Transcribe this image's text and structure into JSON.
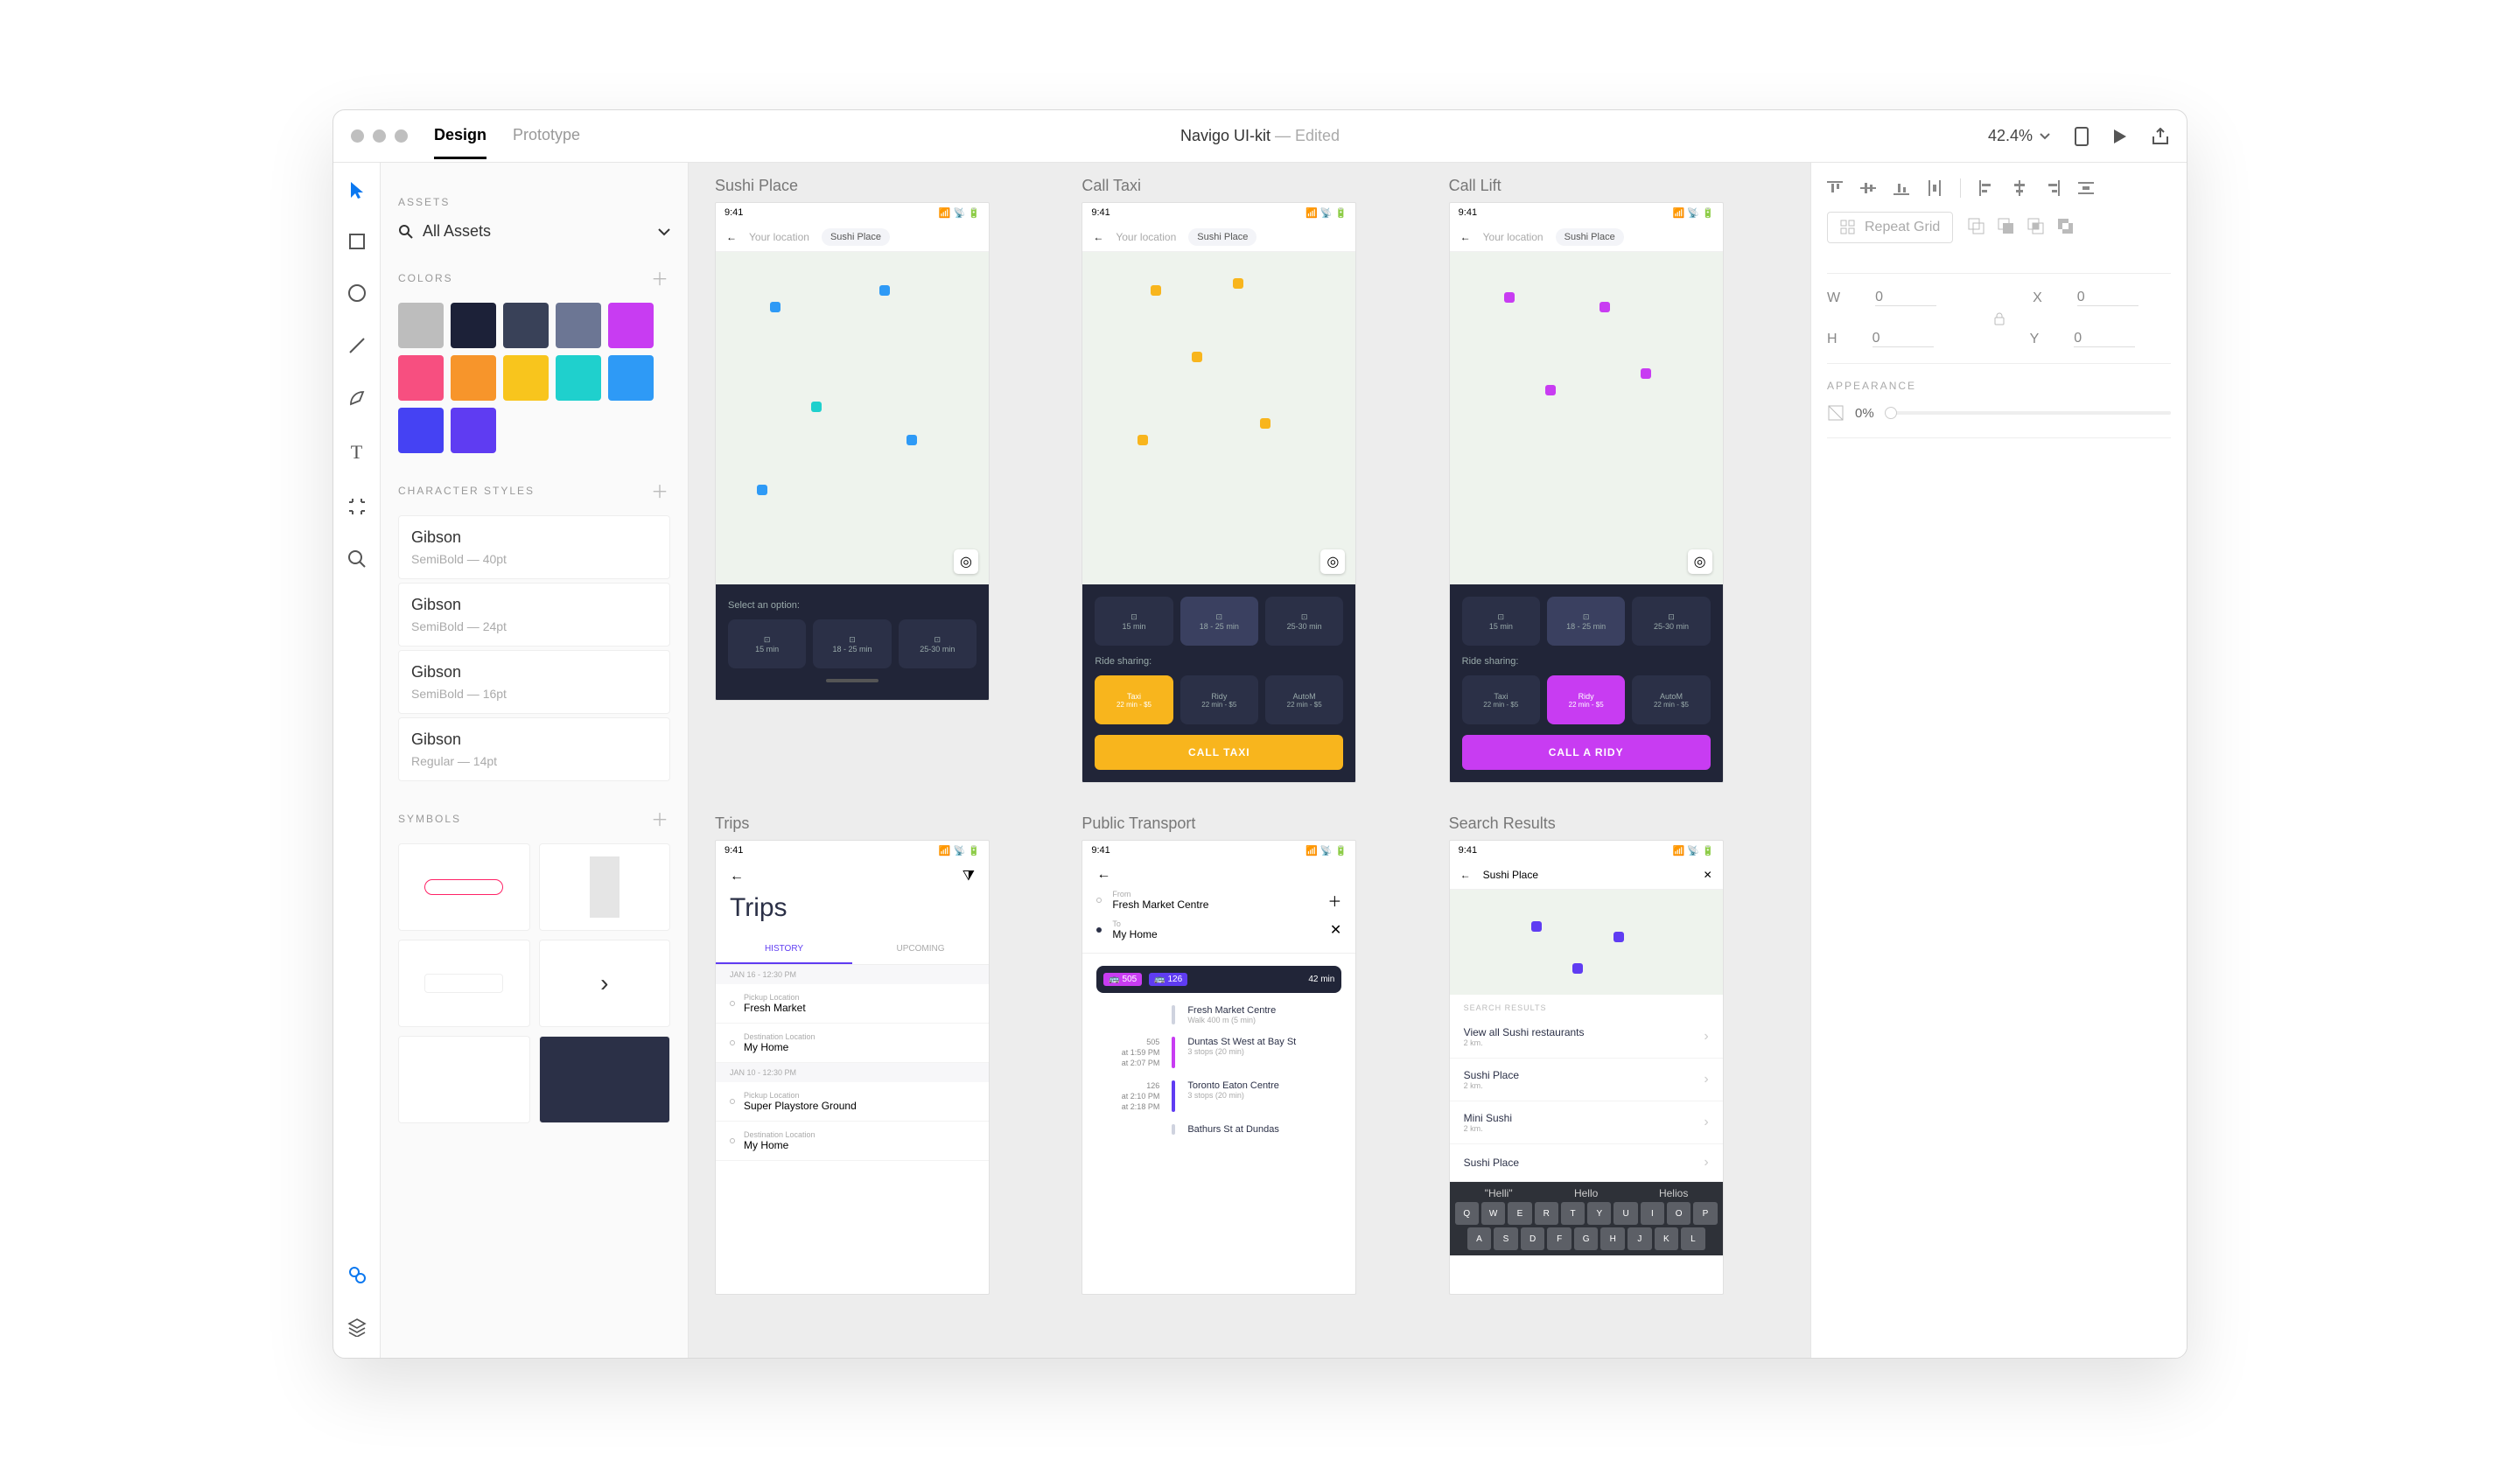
{
  "titlebar": {
    "tabs": {
      "design": "Design",
      "prototype": "Prototype"
    },
    "doc": "Navigo UI-kit",
    "edited": " — Edited",
    "zoom": "42.4%"
  },
  "assets": {
    "header": "ASSETS",
    "dropdown": "All Assets",
    "colors_header": "Colors",
    "swatches": [
      "#bdbdbd",
      "#1c2138",
      "#394158",
      "#6c7694",
      "#c83cf2",
      "#f74f80",
      "#f7952b",
      "#f8c51d",
      "#1fd0cd",
      "#2e9af6",
      "#4542f3",
      "#5f3cf2"
    ],
    "cs_header": "Character Styles",
    "cs": [
      {
        "name": "Gibson",
        "detail": "SemiBold — 40pt"
      },
      {
        "name": "Gibson",
        "detail": "SemiBold — 24pt"
      },
      {
        "name": "Gibson",
        "detail": "SemiBold — 16pt"
      },
      {
        "name": "Gibson",
        "detail": "Regular — 14pt"
      }
    ],
    "sym_header": "Symbols"
  },
  "artboards": {
    "r1": [
      {
        "label": "Sushi Place",
        "time": "9:41",
        "nav_from": "Your location",
        "nav_to": "Sushi Place",
        "sheet": {
          "prompt": "Select an option:",
          "cards": [
            {
              "t": "",
              "s": "15 min"
            },
            {
              "t": "",
              "s": "18 - 25 min"
            },
            {
              "t": "",
              "s": "25-30 min"
            }
          ]
        }
      },
      {
        "label": "Call Taxi",
        "time": "9:41",
        "nav_from": "Your location",
        "nav_to": "Sushi Place",
        "sheet": {
          "cards": [
            {
              "s": "15 min"
            },
            {
              "s": "18 - 25 min"
            },
            {
              "s": "25-30 min"
            }
          ],
          "share": "Ride sharing:",
          "opts": [
            {
              "n": "Taxi",
              "d": "22 min - $5"
            },
            {
              "n": "Ridy",
              "d": "22 min - $5"
            },
            {
              "n": "AutoM",
              "d": "22 min - $5"
            }
          ],
          "cta": "CALL TAXI",
          "accent": "#f8b51d"
        }
      },
      {
        "label": "Call Lift",
        "time": "9:41",
        "nav_from": "Your location",
        "nav_to": "Sushi Place",
        "sheet": {
          "cards": [
            {
              "s": "15 min"
            },
            {
              "s": "18 - 25 min"
            },
            {
              "s": "25-30 min"
            }
          ],
          "share": "Ride sharing:",
          "opts": [
            {
              "n": "Taxi",
              "d": "22 min - $5"
            },
            {
              "n": "Ridy",
              "d": "22 min - $5"
            },
            {
              "n": "AutoM",
              "d": "22 min - $5"
            }
          ],
          "cta": "CALL A RIDY",
          "accent": "#c83cf2"
        }
      }
    ],
    "r2": [
      {
        "label": "Trips",
        "time": "9:41",
        "title": "Trips",
        "tabs": [
          "HISTORY",
          "UPCOMING"
        ],
        "groups": [
          {
            "date": "JAN 16 - 12:30 PM",
            "rows": [
              {
                "l": "Pickup Location",
                "v": "Fresh Market"
              },
              {
                "l": "Destination Location",
                "v": "My Home"
              }
            ]
          },
          {
            "date": "JAN 10 - 12:30 PM",
            "rows": [
              {
                "l": "Pickup Location",
                "v": "Super Playstore Ground"
              },
              {
                "l": "Destination Location",
                "v": "My Home"
              }
            ]
          }
        ]
      },
      {
        "label": "Public Transport",
        "time": "9:41",
        "from_l": "From",
        "from_v": "Fresh Market Centre",
        "to_l": "To",
        "to_v": "My Home",
        "summary": {
          "a": "505",
          "b": "126",
          "dur": "42 min"
        },
        "steps": [
          {
            "left": "",
            "title": "Fresh Market Centre",
            "sub": "Walk 400 m (5 min)",
            "color": "#cfd3df"
          },
          {
            "left": "505\nat 1:59 PM\nat 2:07 PM",
            "title": "Duntas St West at Bay St",
            "sub": "3 stops (20 min)",
            "color": "#c83cf2"
          },
          {
            "left": "126\nat 2:10 PM\nat 2:18 PM",
            "title": "Toronto Eaton Centre",
            "sub": "3 stops (20 min)",
            "color": "#5f3cf2"
          },
          {
            "left": "",
            "title": "Bathurs St at Dundas",
            "sub": "",
            "color": "#cfd3df"
          }
        ]
      },
      {
        "label": "Search Results",
        "time": "9:41",
        "query": "Sushi Place",
        "sect": "SEARCH RESULTS",
        "results": [
          {
            "t": "View all Sushi restaurants",
            "d": "2 km."
          },
          {
            "t": "Sushi Place",
            "d": "2 km."
          },
          {
            "t": "Mini Sushi",
            "d": "2 km."
          },
          {
            "t": "Sushi Place",
            "d": ""
          }
        ],
        "sugs": [
          "\"Helli\"",
          "Hello",
          "Helios"
        ],
        "kb1": [
          "Q",
          "W",
          "E",
          "R",
          "T",
          "Y",
          "U",
          "I",
          "O",
          "P"
        ],
        "kb2": [
          "A",
          "S",
          "D",
          "F",
          "G",
          "H",
          "J",
          "K",
          "L"
        ]
      }
    ]
  },
  "inspector": {
    "repeat": "Repeat Grid",
    "w": "0",
    "x": "0",
    "h": "0",
    "y": "0",
    "appearance": "APPEARANCE",
    "opacity": "0%"
  }
}
